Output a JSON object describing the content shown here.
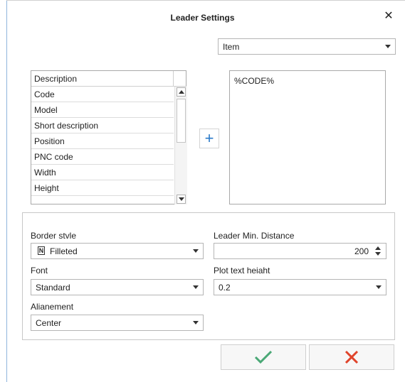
{
  "dialog": {
    "title": "Leader Settings"
  },
  "type_select": {
    "value": "Item"
  },
  "fields_list": {
    "header": "Description",
    "items": [
      "Code",
      "Model",
      "Short description",
      "Position",
      "PNC code",
      "Width",
      "Height"
    ]
  },
  "template_text": "%CODE%",
  "settings": {
    "border_style": {
      "label": "Border stvle",
      "value": "Filleted",
      "icon": "filleted-border-icon",
      "icon_glyph": "N"
    },
    "leader_min_distance": {
      "label": "Leader Min. Distance",
      "value": "200"
    },
    "font": {
      "label": "Font",
      "value": "Standard"
    },
    "plot_text_height": {
      "label": "Plot text heiaht",
      "value": "0.2"
    },
    "alignement": {
      "label": "Alianement",
      "value": "Center"
    }
  },
  "colors": {
    "ok": "#4aa876",
    "cancel": "#e0442b",
    "plus": "#2a7ac8"
  }
}
